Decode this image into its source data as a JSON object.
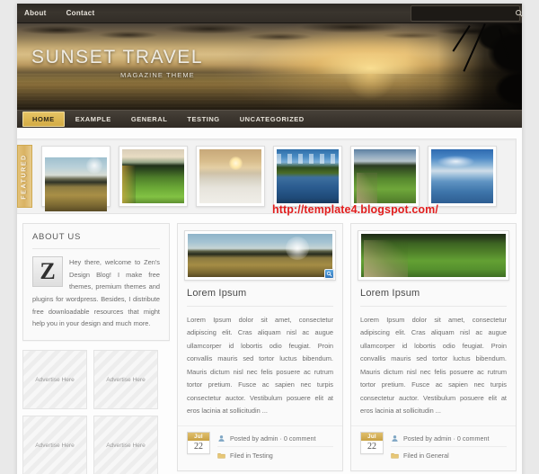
{
  "site": {
    "title": "SUNSET TRAVEL",
    "tagline": "MAGAZINE THEME"
  },
  "topbar": {
    "links": [
      {
        "label": "About"
      },
      {
        "label": "Contact"
      }
    ],
    "search": {
      "value": "",
      "placeholder": "",
      "icon": "search-icon"
    }
  },
  "nav": {
    "items": [
      {
        "label": "HOME",
        "active": true
      },
      {
        "label": "EXAMPLE",
        "active": false
      },
      {
        "label": "GENERAL",
        "active": false
      },
      {
        "label": "TESTING",
        "active": false
      },
      {
        "label": "UNCATEGORIZED",
        "active": false
      }
    ]
  },
  "featured": {
    "label": "FEATURED",
    "thumbnails": [
      {
        "alt": "wheat-field-at-dusk",
        "style": "ph-wheat"
      },
      {
        "alt": "green-crop-rows",
        "style": "ph-field"
      },
      {
        "alt": "winter-field-with-horse",
        "style": "ph-winter"
      },
      {
        "alt": "lake-reflection-autumn-trees",
        "style": "ph-lake"
      },
      {
        "alt": "country-road-beside-green-field",
        "style": "ph-road"
      },
      {
        "alt": "blue-sea-and-clouds",
        "style": "ph-sea"
      }
    ]
  },
  "watermark": "http://template4.blogspot.com/",
  "sidebar": {
    "about": {
      "title": "ABOUT US",
      "logo_letter": "Z",
      "text": "Hey there, welcome to Zen's Design Blog! I make free themes, premium themes and plugins for wordpress. Besides, I distribute free downloadable resources that might help you in your design and much more."
    },
    "ads": [
      {
        "label": "Advertise Here"
      },
      {
        "label": "Advertise Here"
      },
      {
        "label": "Advertise Here"
      },
      {
        "label": "Advertise Here"
      }
    ]
  },
  "posts": [
    {
      "title": "Lorem Ipsum",
      "image_alt": "wheat-field-with-moon",
      "image_style": "ph-post1",
      "has_zoom_badge": true,
      "excerpt": "Lorem Ipsum dolor sit amet, consectetur adipiscing elit. Cras aliquam nisl ac augue ullamcorper id lobortis odio feugiat. Proin convallis mauris sed tortor luctus bibendum. Mauris dictum nisl nec felis posuere ac rutrum tortor pretium. Fusce ac sapien nec turpis consectetur auctor. Vestibulum posuere elit at eros lacinia at sollicitudin ...",
      "date": {
        "month": "Jul",
        "day": "22"
      },
      "meta": {
        "author_line": "Posted by admin  ·  0 comment",
        "filed_line": "Filed in Testing"
      }
    },
    {
      "title": "Lorem Ipsum",
      "image_alt": "country-road-and-green-field",
      "image_style": "ph-post2",
      "has_zoom_badge": false,
      "excerpt": "Lorem Ipsum dolor sit amet, consectetur adipiscing elit. Cras aliquam nisl ac augue ullamcorper id lobortis odio feugiat. Proin convallis mauris sed tortor luctus bibendum. Mauris dictum nisl nec felis posuere ac rutrum tortor pretium. Fusce ac sapien nec turpis consectetur auctor. Vestibulum posuere elit at eros lacinia at sollicitudin ...",
      "date": {
        "month": "Jul",
        "day": "22"
      },
      "meta": {
        "author_line": "Posted by admin  ·  0 comment",
        "filed_line": "Filed in General"
      }
    }
  ],
  "colors": {
    "accent_gold": "#d3ab45",
    "dark_bar": "#322d27",
    "page_bg": "#e9e9e9",
    "watermark_red": "#e21d1d"
  }
}
